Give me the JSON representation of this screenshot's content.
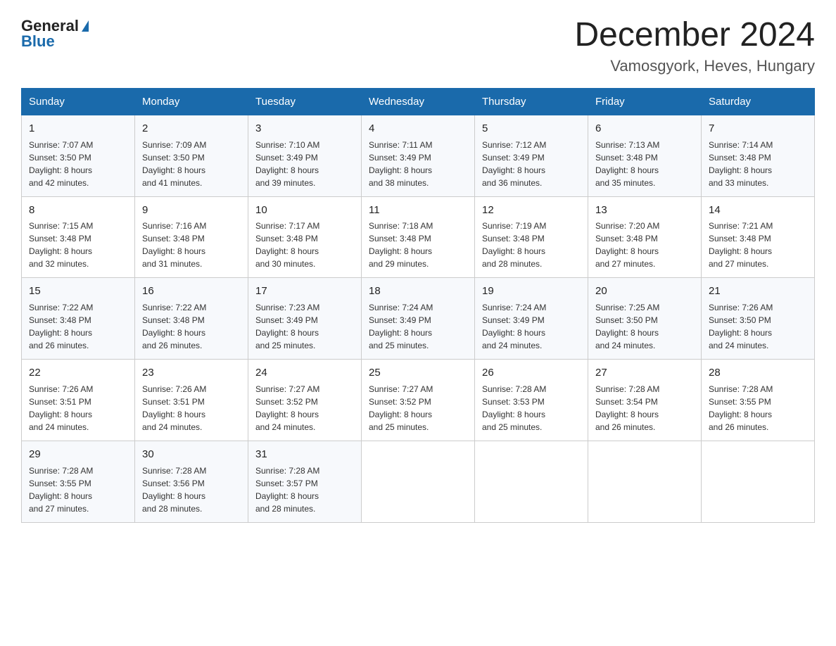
{
  "header": {
    "logo_general": "General",
    "logo_blue": "Blue",
    "month_title": "December 2024",
    "location": "Vamosgyork, Heves, Hungary"
  },
  "days_of_week": [
    "Sunday",
    "Monday",
    "Tuesday",
    "Wednesday",
    "Thursday",
    "Friday",
    "Saturday"
  ],
  "weeks": [
    [
      {
        "day": "1",
        "sunrise": "7:07 AM",
        "sunset": "3:50 PM",
        "daylight": "8 hours and 42 minutes."
      },
      {
        "day": "2",
        "sunrise": "7:09 AM",
        "sunset": "3:50 PM",
        "daylight": "8 hours and 41 minutes."
      },
      {
        "day": "3",
        "sunrise": "7:10 AM",
        "sunset": "3:49 PM",
        "daylight": "8 hours and 39 minutes."
      },
      {
        "day": "4",
        "sunrise": "7:11 AM",
        "sunset": "3:49 PM",
        "daylight": "8 hours and 38 minutes."
      },
      {
        "day": "5",
        "sunrise": "7:12 AM",
        "sunset": "3:49 PM",
        "daylight": "8 hours and 36 minutes."
      },
      {
        "day": "6",
        "sunrise": "7:13 AM",
        "sunset": "3:48 PM",
        "daylight": "8 hours and 35 minutes."
      },
      {
        "day": "7",
        "sunrise": "7:14 AM",
        "sunset": "3:48 PM",
        "daylight": "8 hours and 33 minutes."
      }
    ],
    [
      {
        "day": "8",
        "sunrise": "7:15 AM",
        "sunset": "3:48 PM",
        "daylight": "8 hours and 32 minutes."
      },
      {
        "day": "9",
        "sunrise": "7:16 AM",
        "sunset": "3:48 PM",
        "daylight": "8 hours and 31 minutes."
      },
      {
        "day": "10",
        "sunrise": "7:17 AM",
        "sunset": "3:48 PM",
        "daylight": "8 hours and 30 minutes."
      },
      {
        "day": "11",
        "sunrise": "7:18 AM",
        "sunset": "3:48 PM",
        "daylight": "8 hours and 29 minutes."
      },
      {
        "day": "12",
        "sunrise": "7:19 AM",
        "sunset": "3:48 PM",
        "daylight": "8 hours and 28 minutes."
      },
      {
        "day": "13",
        "sunrise": "7:20 AM",
        "sunset": "3:48 PM",
        "daylight": "8 hours and 27 minutes."
      },
      {
        "day": "14",
        "sunrise": "7:21 AM",
        "sunset": "3:48 PM",
        "daylight": "8 hours and 27 minutes."
      }
    ],
    [
      {
        "day": "15",
        "sunrise": "7:22 AM",
        "sunset": "3:48 PM",
        "daylight": "8 hours and 26 minutes."
      },
      {
        "day": "16",
        "sunrise": "7:22 AM",
        "sunset": "3:48 PM",
        "daylight": "8 hours and 26 minutes."
      },
      {
        "day": "17",
        "sunrise": "7:23 AM",
        "sunset": "3:49 PM",
        "daylight": "8 hours and 25 minutes."
      },
      {
        "day": "18",
        "sunrise": "7:24 AM",
        "sunset": "3:49 PM",
        "daylight": "8 hours and 25 minutes."
      },
      {
        "day": "19",
        "sunrise": "7:24 AM",
        "sunset": "3:49 PM",
        "daylight": "8 hours and 24 minutes."
      },
      {
        "day": "20",
        "sunrise": "7:25 AM",
        "sunset": "3:50 PM",
        "daylight": "8 hours and 24 minutes."
      },
      {
        "day": "21",
        "sunrise": "7:26 AM",
        "sunset": "3:50 PM",
        "daylight": "8 hours and 24 minutes."
      }
    ],
    [
      {
        "day": "22",
        "sunrise": "7:26 AM",
        "sunset": "3:51 PM",
        "daylight": "8 hours and 24 minutes."
      },
      {
        "day": "23",
        "sunrise": "7:26 AM",
        "sunset": "3:51 PM",
        "daylight": "8 hours and 24 minutes."
      },
      {
        "day": "24",
        "sunrise": "7:27 AM",
        "sunset": "3:52 PM",
        "daylight": "8 hours and 24 minutes."
      },
      {
        "day": "25",
        "sunrise": "7:27 AM",
        "sunset": "3:52 PM",
        "daylight": "8 hours and 25 minutes."
      },
      {
        "day": "26",
        "sunrise": "7:28 AM",
        "sunset": "3:53 PM",
        "daylight": "8 hours and 25 minutes."
      },
      {
        "day": "27",
        "sunrise": "7:28 AM",
        "sunset": "3:54 PM",
        "daylight": "8 hours and 26 minutes."
      },
      {
        "day": "28",
        "sunrise": "7:28 AM",
        "sunset": "3:55 PM",
        "daylight": "8 hours and 26 minutes."
      }
    ],
    [
      {
        "day": "29",
        "sunrise": "7:28 AM",
        "sunset": "3:55 PM",
        "daylight": "8 hours and 27 minutes."
      },
      {
        "day": "30",
        "sunrise": "7:28 AM",
        "sunset": "3:56 PM",
        "daylight": "8 hours and 28 minutes."
      },
      {
        "day": "31",
        "sunrise": "7:28 AM",
        "sunset": "3:57 PM",
        "daylight": "8 hours and 28 minutes."
      },
      null,
      null,
      null,
      null
    ]
  ],
  "labels": {
    "sunrise": "Sunrise: ",
    "sunset": "Sunset: ",
    "daylight": "Daylight: "
  }
}
